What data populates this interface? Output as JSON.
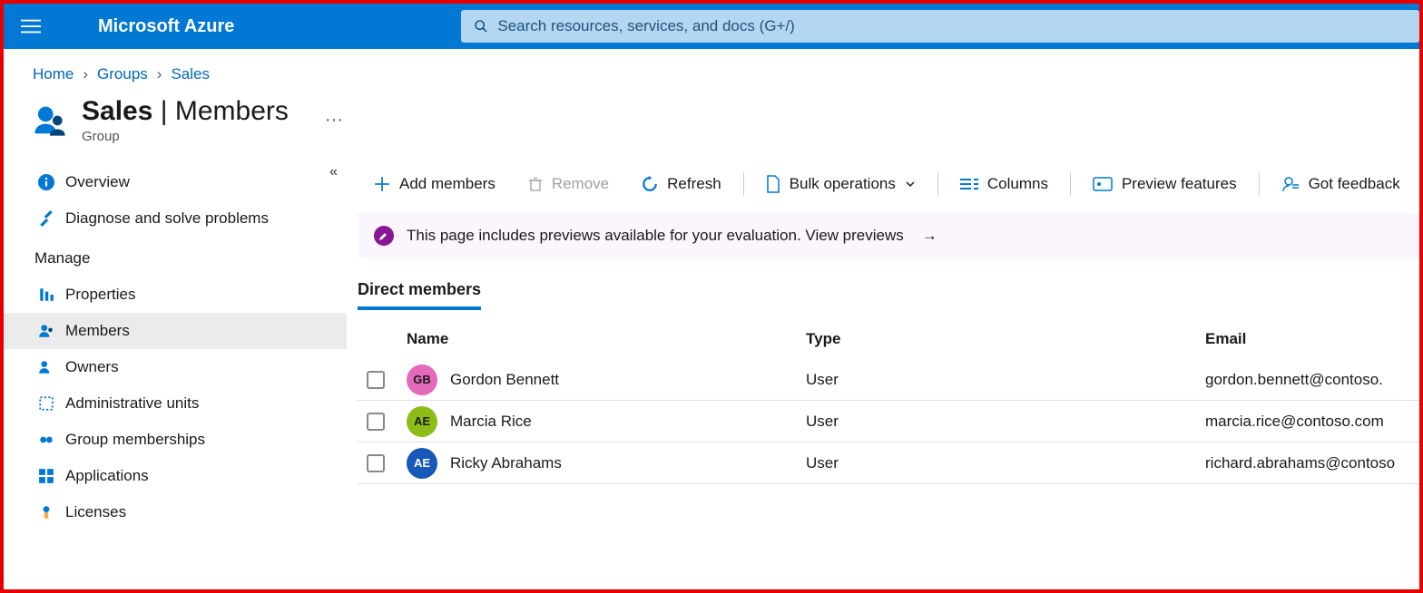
{
  "header": {
    "brand": "Microsoft Azure",
    "search_placeholder": "Search resources, services, and docs (G+/)"
  },
  "breadcrumb": {
    "home": "Home",
    "groups": "Groups",
    "current": "Sales"
  },
  "page": {
    "title_strong": "Sales",
    "title_rest": "Members",
    "subtitle": "Group"
  },
  "sidebar": {
    "collapse_glyph": "«",
    "overview": "Overview",
    "diagnose": "Diagnose and solve problems",
    "section_manage": "Manage",
    "properties": "Properties",
    "members": "Members",
    "owners": "Owners",
    "admin_units": "Administrative units",
    "group_memberships": "Group memberships",
    "applications": "Applications",
    "licenses": "Licenses"
  },
  "toolbar": {
    "add_members": "Add members",
    "remove": "Remove",
    "refresh": "Refresh",
    "bulk_ops": "Bulk operations",
    "columns": "Columns",
    "preview": "Preview features",
    "feedback": "Got feedback"
  },
  "banner": {
    "text": "This page includes previews available for your evaluation. View previews"
  },
  "tabs": {
    "direct": "Direct members"
  },
  "columns": {
    "name": "Name",
    "type": "Type",
    "email": "Email"
  },
  "rows": [
    {
      "initials": "GB",
      "color": "#e36ab8",
      "name": "Gordon Bennett",
      "type": "User",
      "email": "gordon.bennett@contoso."
    },
    {
      "initials": "AE",
      "color": "#8cbd18",
      "name": "Marcia Rice",
      "type": "User",
      "email": "marcia.rice@contoso.com"
    },
    {
      "initials": "AE",
      "color": "#1858b8",
      "textcolor": "#fff",
      "name": "Ricky Abrahams",
      "type": "User",
      "email": "richard.abrahams@contoso"
    }
  ]
}
